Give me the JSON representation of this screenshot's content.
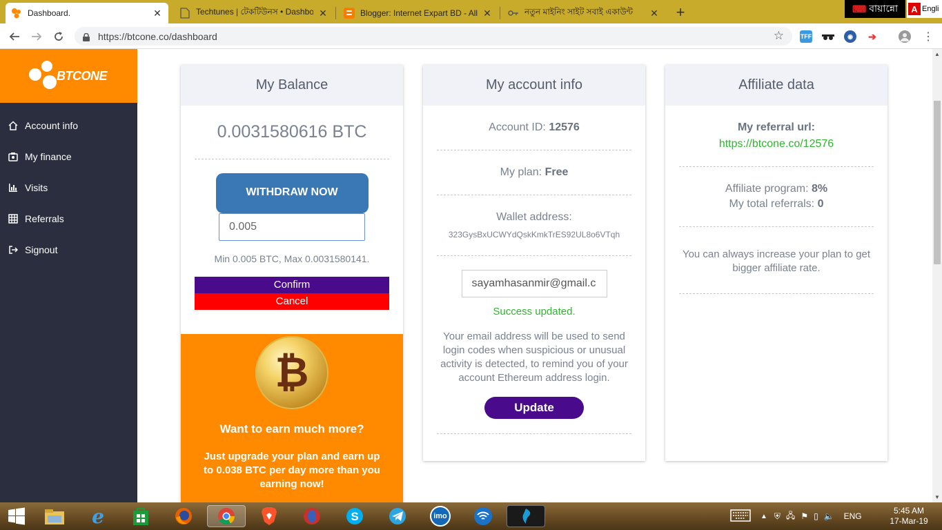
{
  "browser": {
    "tabs": [
      {
        "title": "Dashboard.",
        "active": true
      },
      {
        "title": "Techtunes | টেকটিউনস • Dashbo"
      },
      {
        "title": "Blogger: Internet Expart BD - All"
      },
      {
        "title": "নতুন মাইনিং সাইট সবাই একাউন্ট"
      }
    ],
    "url": "https://btcone.co/dashboard",
    "ime_bangla": "বায়ান্নো",
    "ime_english": "Engli"
  },
  "sidebar": {
    "logo_text": "BTCONE",
    "items": [
      {
        "label": "Account info",
        "icon": "home-icon"
      },
      {
        "label": "My finance",
        "icon": "finance-icon"
      },
      {
        "label": "Visits",
        "icon": "bar-chart-icon"
      },
      {
        "label": "Referrals",
        "icon": "grid-icon"
      },
      {
        "label": "Signout",
        "icon": "signout-icon"
      }
    ]
  },
  "balance": {
    "title": "My Balance",
    "amount": "0.0031580616 BTC",
    "withdraw_label": "WITHDRAW NOW",
    "input_value": "0.005",
    "limits": "Min 0.005 BTC, Max 0.0031580141.",
    "confirm_label": "Confirm",
    "cancel_label": "Cancel",
    "promo_title": "Want to earn much more?",
    "promo_text_1": "Just upgrade your plan and earn up to ",
    "promo_amount": "0.038 BTC",
    "promo_text_2": " per day more than you earning now!"
  },
  "account": {
    "title": "My account info",
    "id_label": "Account ID: ",
    "id_value": "12576",
    "plan_label": "My plan: ",
    "plan_value": "Free",
    "wallet_label": "Wallet address:",
    "wallet_value": "323GysBxUCWYdQskKmkTrES92UL8o6VTqh",
    "email_value": "sayamhasanmir@gmail.c",
    "success": "Success updated.",
    "description": "Your email address will be used to send login codes when suspicious or unusual activity is detected, to remind you of your account Ethereum address login.",
    "update_label": "Update"
  },
  "affiliate": {
    "title": "Affiliate data",
    "url_label": "My referral url:",
    "url_value": "https://btcone.co/12576",
    "program_label": "Affiliate program: ",
    "program_value": "8%",
    "referrals_label": "My total referrals: ",
    "referrals_value": "0",
    "upgrade_text": "You can always increase your plan to get bigger affiliate rate."
  },
  "taskbar": {
    "lang": "ENG",
    "time": "5:45 AM",
    "date": "17-Mar-19",
    "imo_label": "imo"
  },
  "colors": {
    "brand_orange": "#ff8a00",
    "sidebar_bg": "#2a2e3e",
    "withdraw_blue": "#3a78b5",
    "purple": "#4a0a8c",
    "cancel_red": "#ff0000",
    "success_green": "#2fb52f"
  }
}
